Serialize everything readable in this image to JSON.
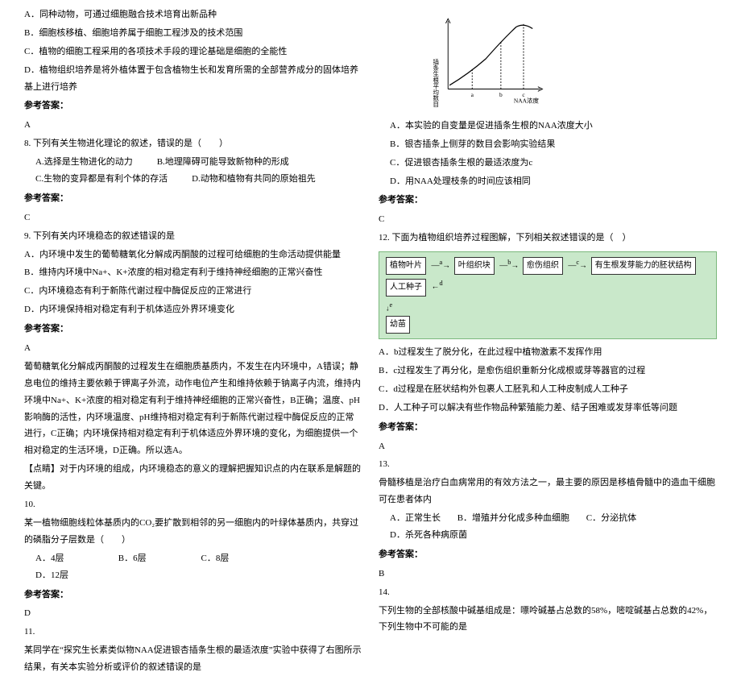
{
  "left": {
    "q7": {
      "A": "A．同种动物，可通过细胞融合技术培育出新品种",
      "B": "B．细胞核移植、细胞培养属于细胞工程涉及的技术范围",
      "C": "C．植物的细胞工程采用的各项技术手段的理论基础是细胞的全能性",
      "D": "D．植物组织培养是将外植体置于包含植物生长和发育所需的全部营养成分的固体培养基上进行培养"
    },
    "ans_label": "参考答案：",
    "q7ans": "A",
    "q8": {
      "stem": "8. 下列有关生物进化理论的叙述，错误的是（　　）",
      "A": "A.选择是生物进化的动力",
      "B": "B.地理障碍可能导致新物种的形成",
      "C": "C.生物的变异都是有利个体的存活",
      "D": "D.动物和植物有共同的原始祖先"
    },
    "q8ans": "C",
    "q9": {
      "stem": "9. 下列有关内环境稳态的叙述错误的是",
      "A": "A．内环境中发生的葡萄糖氧化分解成丙酮酸的过程可给细胞的生命活动提供能量",
      "B": "B．维持内环境中Na+、K+浓度的相对稳定有利于维持神经细胞的正常兴奋性",
      "C": "C．内环境稳态有利于新陈代谢过程中酶促反应的正常进行",
      "D": "D．内环境保持相对稳定有利于机体适应外界环境变化"
    },
    "q9ans": "A",
    "q9exp1": "葡萄糖氧化分解成丙酮酸的过程发生在细胞质基质内，不发生在内环境中，A错误；静息电位的维持主要依赖于钾离子外流，动作电位产生和维持依赖于钠离子内流，维持内环境中Na+、K+浓度的相对稳定有利于维持神经细胞的正常兴奋性，B正确；温度、pH影响酶的活性，内环境温度、pH维持相对稳定有利于新陈代谢过程中酶促反应的正常进行，C正确；内环境保持相对稳定有利于机体适应外界环境的变化，为细胞提供一个相对稳定的生活环境，D正确。所以选A。",
    "q9exp2": "【点睛】对于内环境的组成，内环境稳态的意义的理解把握知识点的内在联系是解题的关键。",
    "q10": {
      "num": "10.",
      "stem": "某一植物细胞线粒体基质内的CO₂要扩散到相邻的另一细胞内的叶绿体基质内，共穿过的磷脂分子层数是（　　）",
      "A": "A．4层",
      "B": "B．6层",
      "C": "C．8层",
      "D": "D．12层"
    },
    "q10ans": "D",
    "q11": {
      "num": "11.",
      "stem": "某同学在“探究生长素类似物NAA促进银杏插条生根的最适浓度”实验中获得了右图所示结果，有关本实验分析或评价的叙述错误的是"
    }
  },
  "right": {
    "chart_ylabel": "插条生根平均数目",
    "chart_xlabel": "NAA浓度",
    "q11opts": {
      "A": "A．本实验的自变量是促进插条生根的NAA浓度大小",
      "B": "B．银杏插条上侧芽的数目会影响实验结果",
      "C": "C．促进银杏插条生根的最适浓度为c",
      "D": "D．用NAA处理枝条的时间应该相同"
    },
    "q11ans": "C",
    "q12": {
      "stem": "12. 下面为植物组织培养过程图解，下列相关叙述错误的是（　）",
      "flow": {
        "a": "植物叶片",
        "b": "叶组织块",
        "c": "愈伤组织",
        "d": "有生根发芽能力的胚状结构",
        "e": "人工种子",
        "f": "幼苗"
      },
      "labels": {
        "a": "a",
        "b": "b",
        "c": "c",
        "d": "d",
        "e": "e"
      },
      "A": "A．b过程发生了脱分化，在此过程中植物激素不发挥作用",
      "B": "B．c过程发生了再分化，是愈伤组织重新分化成根或芽等器官的过程",
      "C": "C．d过程是在胚状结构外包裹人工胚乳和人工种皮制成人工种子",
      "D": "D．人工种子可以解决有些作物品种繁殖能力差、结子困难或发芽率低等问题"
    },
    "q12ans": "A",
    "q13": {
      "num": "13.",
      "stem": "骨髓移植是治疗白血病常用的有效方法之一，最主要的原因是移植骨髓中的造血干细胞可在患者体内",
      "A": "A．正常生长",
      "B": "B．增殖并分化成多种血细胞",
      "C": "C．分泌抗体",
      "D": "D．杀死各种病原菌"
    },
    "q13ans": "B",
    "q14": {
      "num": "14.",
      "stem": "下列生物的全部核酸中碱基组成是：嘌呤碱基占总数的58%，嘧啶碱基占总数的42%，下列生物中不可能的是"
    }
  },
  "chart_data": {
    "type": "line",
    "title": "",
    "xlabel": "NAA浓度",
    "ylabel": "插条生根平均数目",
    "x_ticks": [
      "a",
      "b",
      "c"
    ],
    "x": [
      0,
      1,
      2.0,
      2.3,
      2.6,
      3.0
    ],
    "y": [
      0.4,
      1.1,
      1.9,
      2.4,
      2.7,
      2.55
    ],
    "xlim": [
      0,
      3.2
    ],
    "ylim": [
      0,
      3
    ],
    "note": "curve rises from origin, steepest between b and c, peaks just past c then dips slightly"
  }
}
